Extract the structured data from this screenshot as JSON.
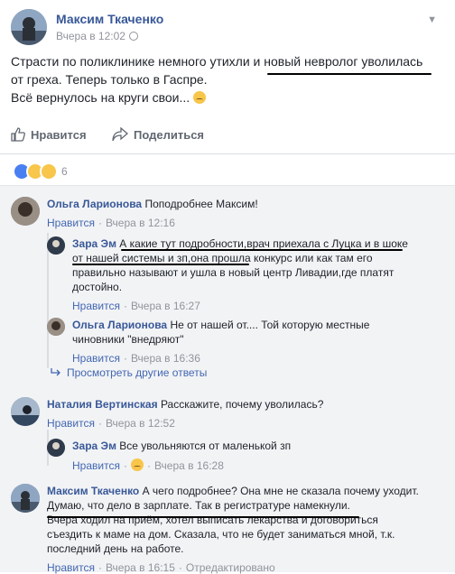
{
  "post": {
    "author": "Максим Ткаченко",
    "time": "Вчера в 12:02",
    "text_lines": [
      "Страсти по поликлинике немного утихли и новый невролог уволилась",
      "от греха. Теперь только в Гаспре.",
      "Всё вернулось на круги свои..."
    ]
  },
  "actions": {
    "like": "Нравится",
    "share": "Поделиться"
  },
  "reactions": {
    "count": "6"
  },
  "labels": {
    "like": "Нравится",
    "reply_more": "Просмотреть другие ответы",
    "edited": "Отредактировано"
  },
  "comments": [
    {
      "author": "Ольга Ларионова",
      "text": "Поподробнее Максим!",
      "time": "Вчера в 12:16"
    },
    {
      "author": "Зара Эм",
      "text_lines": [
        "А какие тут подробности,врач приехала с Луцка и в шоке",
        "от нашей системы и зп,она прошла конкурс или как там его",
        "правильно называют и ушла в новый центр Ливадии,где платят",
        "достойно."
      ],
      "time": "Вчера в 16:27"
    },
    {
      "author": "Ольга Ларионова",
      "text_lines": [
        "Не от нашей от.... Той которую местные",
        "чиновники \"внедряют\""
      ],
      "time": "Вчера в 16:36"
    },
    {
      "author": "Наталия Вертинская",
      "text": "Расскажите, почему уволилась?",
      "time": "Вчера в 12:52"
    },
    {
      "author": "Зара Эм",
      "text": "Все увольняются от маленькой зп",
      "time": "Вчера в 16:28"
    },
    {
      "author": "Максим Ткаченко",
      "text_lines": [
        "А чего подробнее? Она мне не сказала почему уходит.",
        "Думаю, что дело в зарплате. Так в регистратуре намекнули.",
        "Вчера ходил на приём, хотел выписать лекарства и договориться",
        "съездить к маме на дом. Сказала, что не будет заниматься мной, т.к.",
        "последний день на работе."
      ],
      "time": "Вчера в 16:15"
    }
  ],
  "colors": {
    "link": "#385898",
    "meta": "#90949c",
    "comments_bg": "#f2f3f5"
  }
}
